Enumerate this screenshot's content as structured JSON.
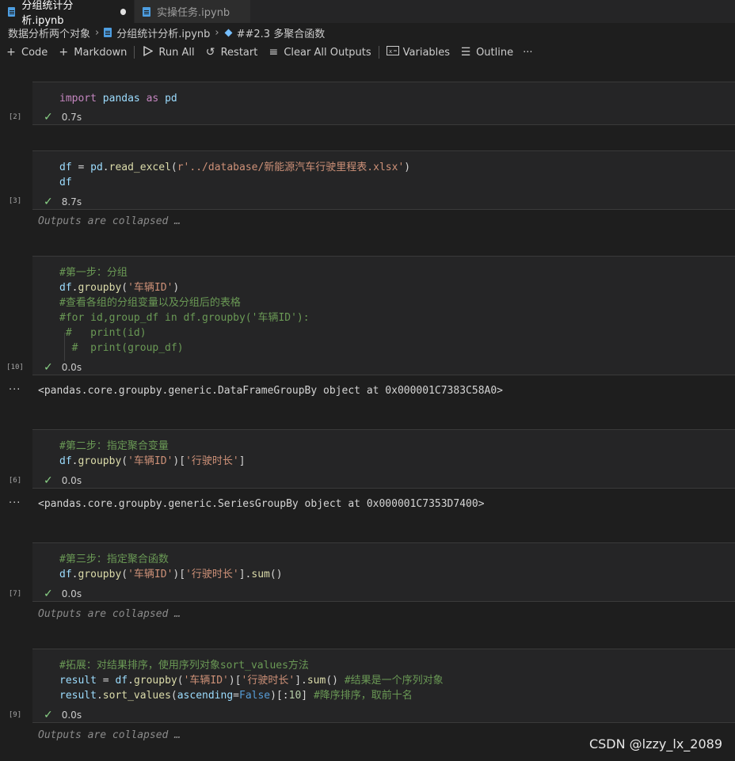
{
  "tabs": [
    {
      "label": "分组统计分析.ipynb",
      "active": true,
      "dirty": true
    },
    {
      "label": "实操任务.ipynb",
      "active": false
    }
  ],
  "breadcrumb": [
    "数据分析两个对象",
    "分组统计分析.ipynb",
    "##2.3 多聚合函数"
  ],
  "toolbar": {
    "code": "Code",
    "markdown": "Markdown",
    "run_all": "Run All",
    "restart": "Restart",
    "clear_all_outputs": "Clear All Outputs",
    "variables": "Variables",
    "outline": "Outline",
    "more": "···"
  },
  "cells": [
    {
      "exec": "[2]",
      "time": "0.7s",
      "lines": [
        "import pandas as pd"
      ]
    },
    {
      "exec": "[3]",
      "time": "8.7s",
      "lines": [
        "df = pd.read_excel(r'../database/新能源汽车行驶里程表.xlsx')",
        "df"
      ],
      "output_collapsed": "Outputs are collapsed …"
    },
    {
      "exec": "[10]",
      "time": "0.0s",
      "lines": [
        "#第一步：分组",
        "df.groupby('车辆ID')",
        "#查看各组的分组变量以及分组后的表格",
        "#for id,group_df in df.groupby('车辆ID'):",
        "#   print(id)",
        "#  print(group_df)"
      ],
      "output": "<pandas.core.groupby.generic.DataFrameGroupBy object at 0x000001C7383C58A0>"
    },
    {
      "exec": "[6]",
      "time": "0.0s",
      "lines": [
        "#第二步：指定聚合变量",
        "df.groupby('车辆ID')['行驶时长']"
      ],
      "output": "<pandas.core.groupby.generic.SeriesGroupBy object at 0x000001C7353D7400>"
    },
    {
      "exec": "[7]",
      "time": "0.0s",
      "lines": [
        "#第三步：指定聚合函数",
        "df.groupby('车辆ID')['行驶时长'].sum()"
      ],
      "output_collapsed": "Outputs are collapsed …"
    },
    {
      "exec": "[9]",
      "time": "0.0s",
      "lines": [
        "#拓展：对结果排序，使用序列对象sort_values方法",
        "result = df.groupby('车辆ID')['行驶时长'].sum() #结果是一个序列对象",
        "result.sort_values(ascending=False)[:10] #降序排序，取前十名"
      ],
      "output_collapsed": "Outputs are collapsed …"
    }
  ],
  "output_more": "···",
  "watermark": "CSDN @lzzy_lx_2089"
}
